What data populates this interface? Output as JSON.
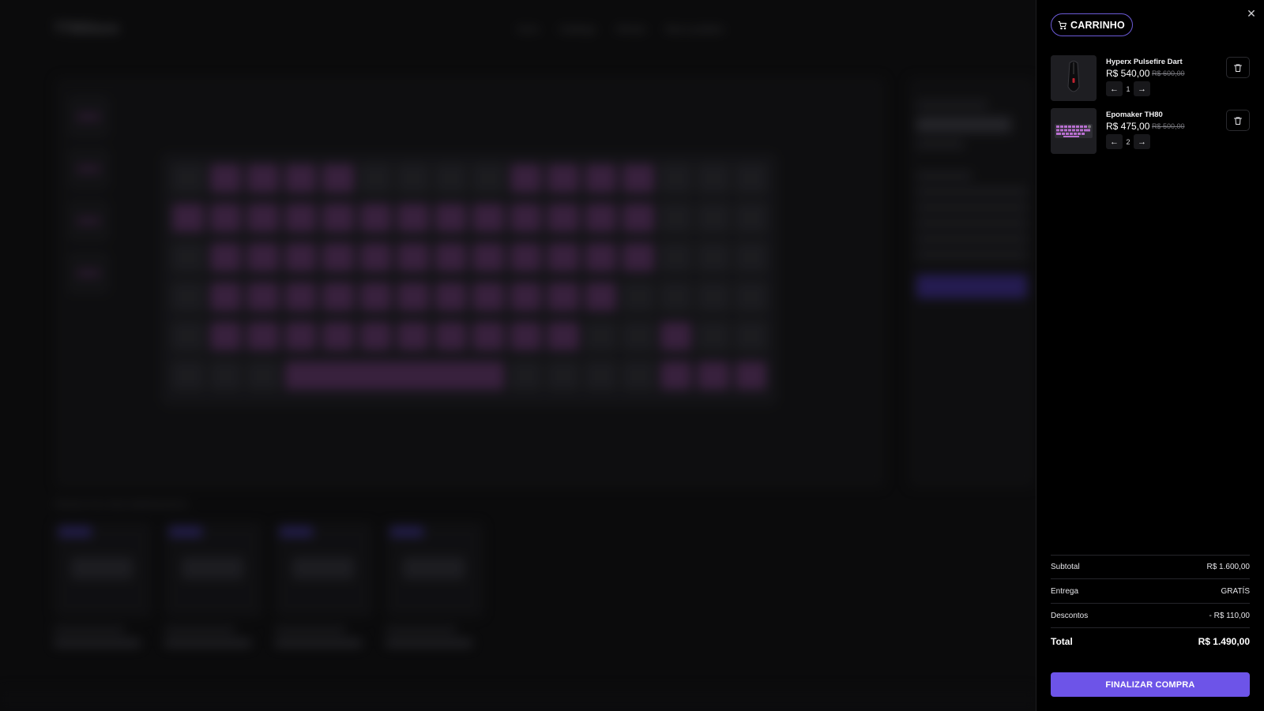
{
  "background_page": {
    "logo": "TTMStore",
    "nav": [
      "Início",
      "Catálogo",
      "Ofertas",
      "Meus pedidos"
    ],
    "section_title": "PRODUTOS RECOMENDADOS"
  },
  "cart": {
    "title": "CARRINHO",
    "items": [
      {
        "name": "Hyperx Pulsefire Dart",
        "price": "R$ 540,00",
        "old_price": "R$ 600,00",
        "quantity": "1"
      },
      {
        "name": "Epomaker TH80",
        "price": "R$ 475,00",
        "old_price": "R$ 500,00",
        "quantity": "2"
      }
    ],
    "summary": {
      "subtotal_label": "Subtotal",
      "subtotal_value": "R$ 1.600,00",
      "delivery_label": "Entrega",
      "delivery_value": "GRATÍS",
      "discount_label": "Descontos",
      "discount_value": "- R$ 110,00",
      "total_label": "Total",
      "total_value": "R$ 1.490,00"
    },
    "checkout_label": "FINALIZAR COMPRA"
  },
  "colors": {
    "accent": "#6d54e8",
    "drawer_bg": "#000000",
    "page_bg": "#0b0b0c"
  }
}
